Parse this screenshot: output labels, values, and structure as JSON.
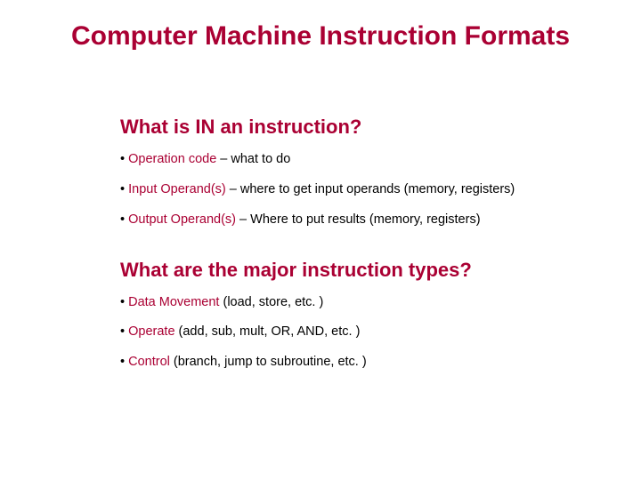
{
  "title": "Computer Machine Instruction Formats",
  "section1": {
    "heading": "What is IN an instruction?",
    "bullets": [
      {
        "lead": "Operation code",
        "rest": " – what to do"
      },
      {
        "lead": "Input Operand(s)",
        "rest": " – where to get input operands (memory, registers)"
      },
      {
        "lead": "Output Operand(s)",
        "rest": " – Where to put results (memory, registers)"
      }
    ]
  },
  "section2": {
    "heading": "What are the major instruction types?",
    "bullets": [
      {
        "lead": "Data Movement",
        "rest": " (load, store, etc. )"
      },
      {
        "lead": "Operate",
        "rest": " (add, sub, mult, OR, AND, etc. )"
      },
      {
        "lead": "Control",
        "rest": " (branch, jump to subroutine, etc. )"
      }
    ]
  }
}
